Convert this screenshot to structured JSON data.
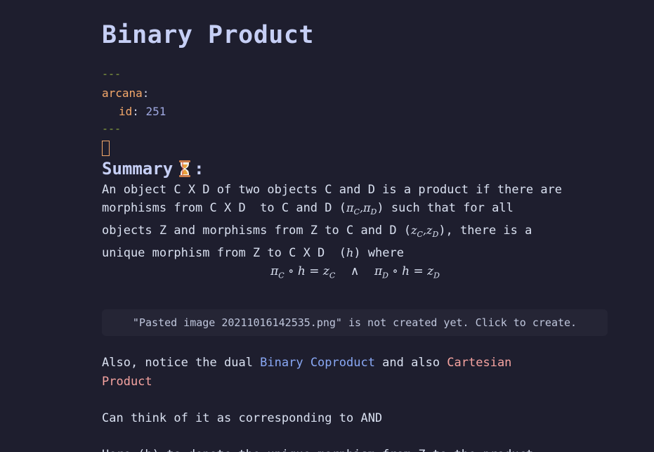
{
  "note": {
    "title": "Binary Product",
    "frontmatter": {
      "dash_open": "---",
      "key": "arcana",
      "sub_key": "id",
      "id_value": "251",
      "dash_close": "---"
    },
    "summary_heading": "Summary",
    "summary_colon": ":",
    "summary_icon": "hourglass-icon",
    "paragraph1": {
      "line1": "An object C X D of two objects C and D is a product if there are",
      "line2_a": "morphisms from C X D  to C and D (",
      "line2_math": "π",
      "line2_b": ") such that for all",
      "line3_a": "objects Z and morphisms from Z to C and D (",
      "line3_b": "), there is a",
      "line4_a": "unique morphism from Z to C X D  (",
      "line4_math": "h",
      "line4_b": ") where"
    },
    "embed_text": "\"Pasted image 20211016142535.png\" is not created yet. Click to create.",
    "paragraph2": {
      "prefix": "Also, notice the dual ",
      "link1": "Binary Coproduct",
      "middle": " and also ",
      "link2_line1": "Cartesian",
      "link2_line2": "Product"
    },
    "paragraph3": "Can think of it as corresponding to AND",
    "paragraph4_partial": "Here (h) to denote the unique morphism from Z to the product"
  },
  "colors": {
    "background": "#1e1e2e",
    "heading": "#c6cff5",
    "frontmatter_dash": "#8aa23f",
    "frontmatter_key": "#f5a96b",
    "link_internal": "#89a8f5",
    "link_unresolved": "#f5a3a0"
  }
}
